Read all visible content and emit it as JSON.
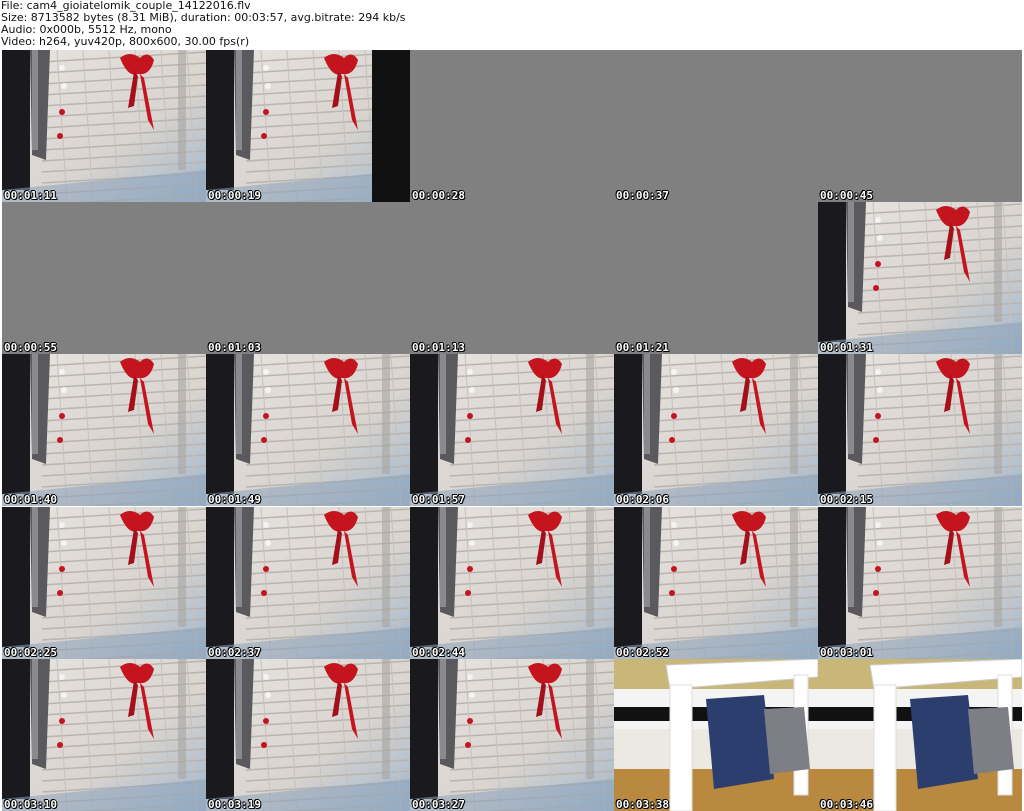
{
  "info": {
    "file": "File: cam4_gioiatelomik_couple_14122016.flv",
    "size": "Size: 8713582 bytes (8.31 MiB), duration: 00:03:57, avg.bitrate: 294 kb/s",
    "audio": "Audio: 0x000b, 5512 Hz, mono",
    "video": "Video: h264, yuv420p, 800x600, 30.00 fps(r)"
  },
  "colors": {
    "empty_frame": "#808080",
    "ribbon": "#c4141e",
    "wall": "#d9d4cf",
    "floor_blue": "#2b3e6e"
  },
  "thumbnails": [
    {
      "time": "00:01:11",
      "scene": "wall"
    },
    {
      "time": "00:00:19",
      "scene": "wall-dark-edge"
    },
    {
      "time": "00:00:28",
      "scene": "empty"
    },
    {
      "time": "00:00:37",
      "scene": "empty"
    },
    {
      "time": "00:00:45",
      "scene": "empty"
    },
    {
      "time": "00:00:55",
      "scene": "empty"
    },
    {
      "time": "00:01:03",
      "scene": "empty"
    },
    {
      "time": "00:01:13",
      "scene": "empty"
    },
    {
      "time": "00:01:21",
      "scene": "empty"
    },
    {
      "time": "00:01:31",
      "scene": "wall"
    },
    {
      "time": "00:01:40",
      "scene": "wall"
    },
    {
      "time": "00:01:49",
      "scene": "wall"
    },
    {
      "time": "00:01:57",
      "scene": "wall"
    },
    {
      "time": "00:02:06",
      "scene": "wall"
    },
    {
      "time": "00:02:15",
      "scene": "wall"
    },
    {
      "time": "00:02:25",
      "scene": "wall"
    },
    {
      "time": "00:02:37",
      "scene": "wall"
    },
    {
      "time": "00:02:44",
      "scene": "wall"
    },
    {
      "time": "00:02:52",
      "scene": "wall"
    },
    {
      "time": "00:03:01",
      "scene": "wall"
    },
    {
      "time": "00:03:10",
      "scene": "wall"
    },
    {
      "time": "00:03:19",
      "scene": "wall"
    },
    {
      "time": "00:03:27",
      "scene": "wall"
    },
    {
      "time": "00:03:38",
      "scene": "table"
    },
    {
      "time": "00:03:46",
      "scene": "table"
    }
  ]
}
